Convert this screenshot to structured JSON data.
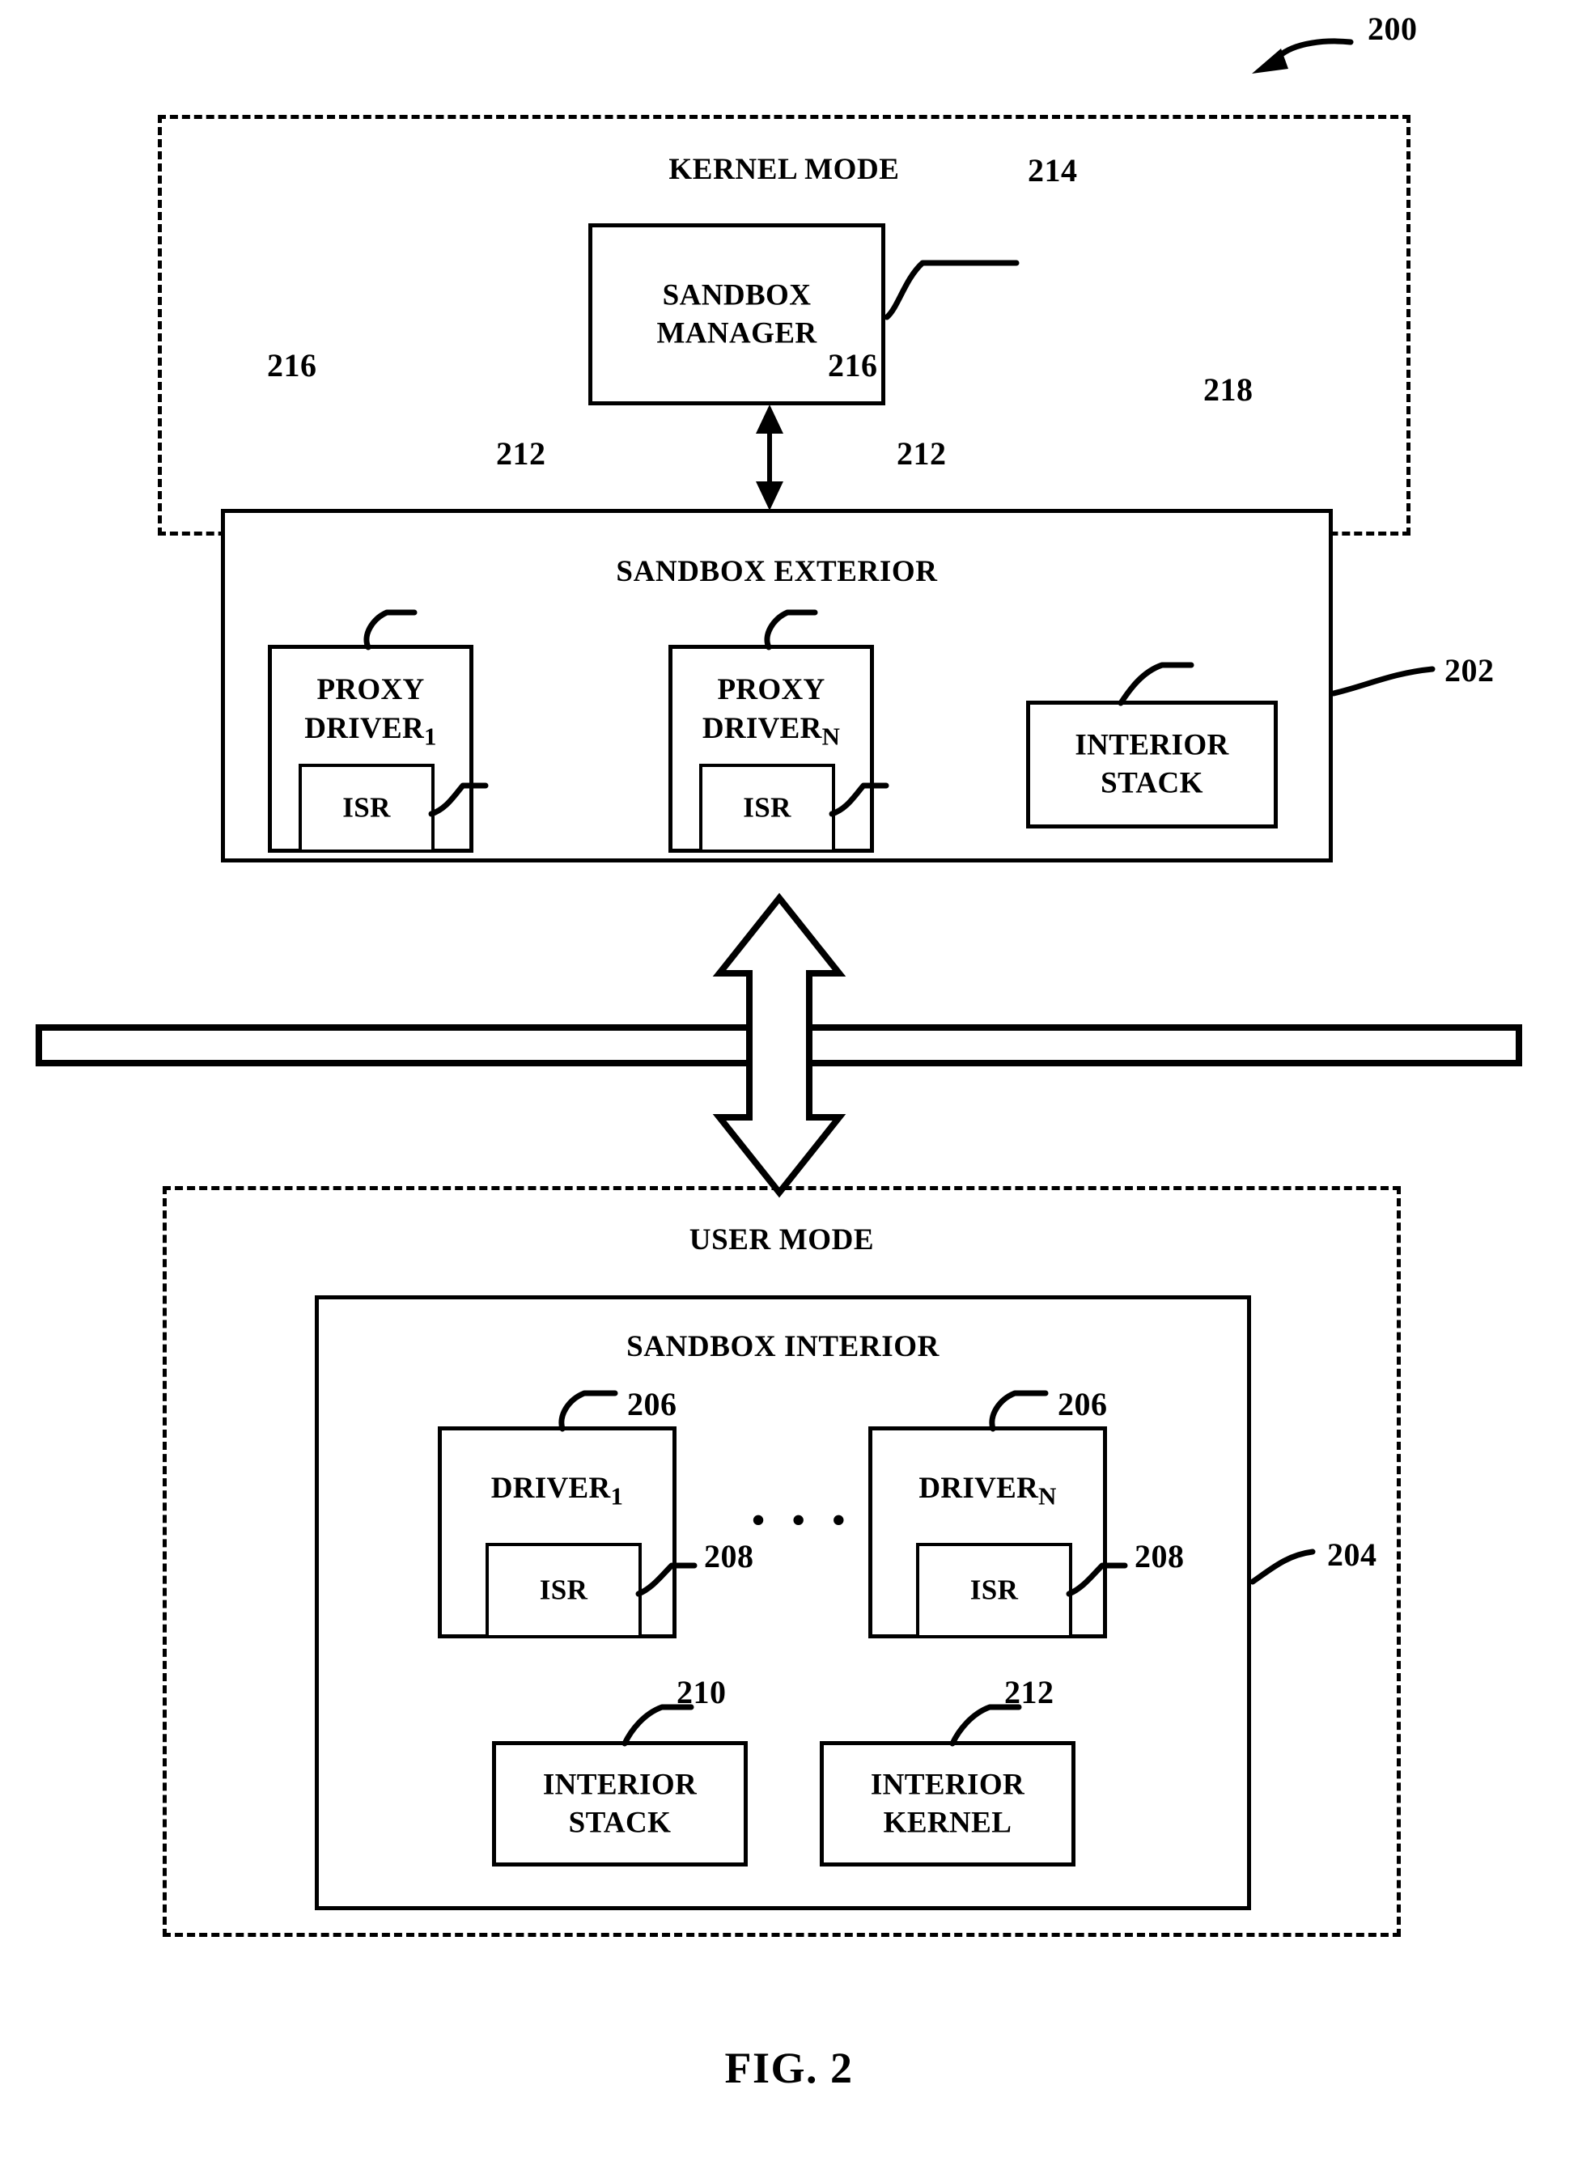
{
  "figure": {
    "caption": "FIG. 2",
    "main_ref": "200"
  },
  "kernel_mode": {
    "title": "KERNEL MODE",
    "sandbox_manager": {
      "label_line1": "SANDBOX",
      "label_line2": "MANAGER",
      "ref": "214"
    },
    "sandbox_exterior": {
      "title": "SANDBOX EXTERIOR",
      "ref": "202",
      "proxy_drivers": [
        {
          "label_line1": "PROXY",
          "label_line2": "DRIVER",
          "subscript": "1",
          "ref": "216",
          "isr": {
            "label": "ISR",
            "ref": "212"
          }
        },
        {
          "label_line1": "PROXY",
          "label_line2": "DRIVER",
          "subscript": "N",
          "ref": "216",
          "isr": {
            "label": "ISR",
            "ref": "212"
          }
        }
      ],
      "interior_stack": {
        "label_line1": "INTERIOR",
        "label_line2": "STACK",
        "ref": "218"
      }
    }
  },
  "user_mode": {
    "title": "USER MODE",
    "sandbox_interior": {
      "title": "SANDBOX INTERIOR",
      "ref": "204",
      "ellipsis": "• • •",
      "drivers": [
        {
          "label": "DRIVER",
          "subscript": "1",
          "ref": "206",
          "isr": {
            "label": "ISR",
            "ref": "208"
          }
        },
        {
          "label": "DRIVER",
          "subscript": "N",
          "ref": "206",
          "isr": {
            "label": "ISR",
            "ref": "208"
          }
        }
      ],
      "interior_stack": {
        "label_line1": "INTERIOR",
        "label_line2": "STACK",
        "ref": "210"
      },
      "interior_kernel": {
        "label_line1": "INTERIOR",
        "label_line2": "KERNEL",
        "ref": "212"
      }
    }
  },
  "colors": {
    "ink": "#000000",
    "paper": "#ffffff"
  }
}
